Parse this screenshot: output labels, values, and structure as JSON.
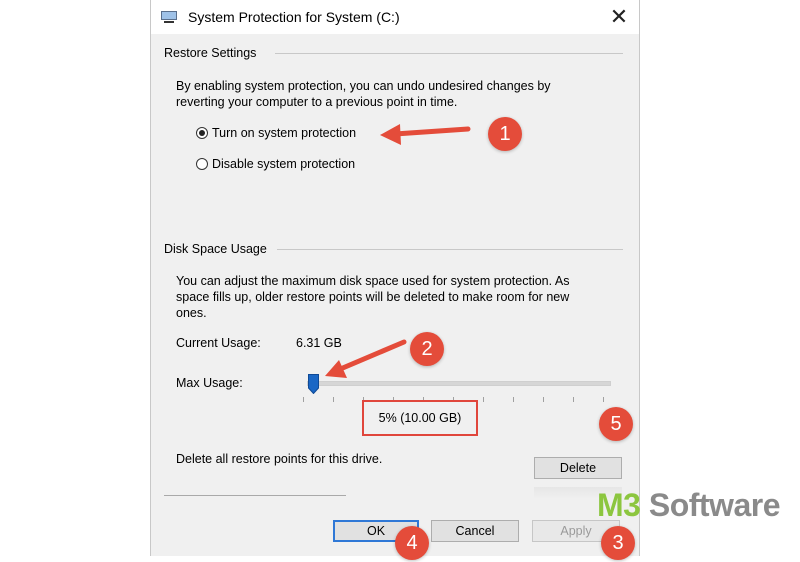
{
  "window": {
    "title": "System Protection for System (C:)",
    "close_glyph": "✕"
  },
  "restore": {
    "heading": "Restore Settings",
    "description": "By enabling system protection, you can undo undesired changes by reverting your computer to a previous point in time.",
    "option_on": "Turn on system protection",
    "option_off": "Disable system protection",
    "selected": "on"
  },
  "disk": {
    "heading": "Disk Space Usage",
    "description": "You can adjust the maximum disk space used for system protection. As space fills up, older restore points will be deleted to make room for new ones.",
    "current_label": "Current Usage:",
    "current_value": "6.31 GB",
    "max_label": "Max Usage:",
    "max_value": "5% (10.00 GB)",
    "slider_fraction": 0.05,
    "delete_text": "Delete all restore points for this drive.",
    "delete_button": "Delete"
  },
  "buttons": {
    "ok": "OK",
    "cancel": "Cancel",
    "apply": "Apply"
  },
  "annotations": [
    "1",
    "2",
    "3",
    "4",
    "5"
  ],
  "brand": {
    "part1": "M3",
    "part2": " Software"
  },
  "colors": {
    "accent_red": "#e44c3a",
    "slider_blue": "#1a67c5",
    "brand_green": "#8cc63f"
  }
}
